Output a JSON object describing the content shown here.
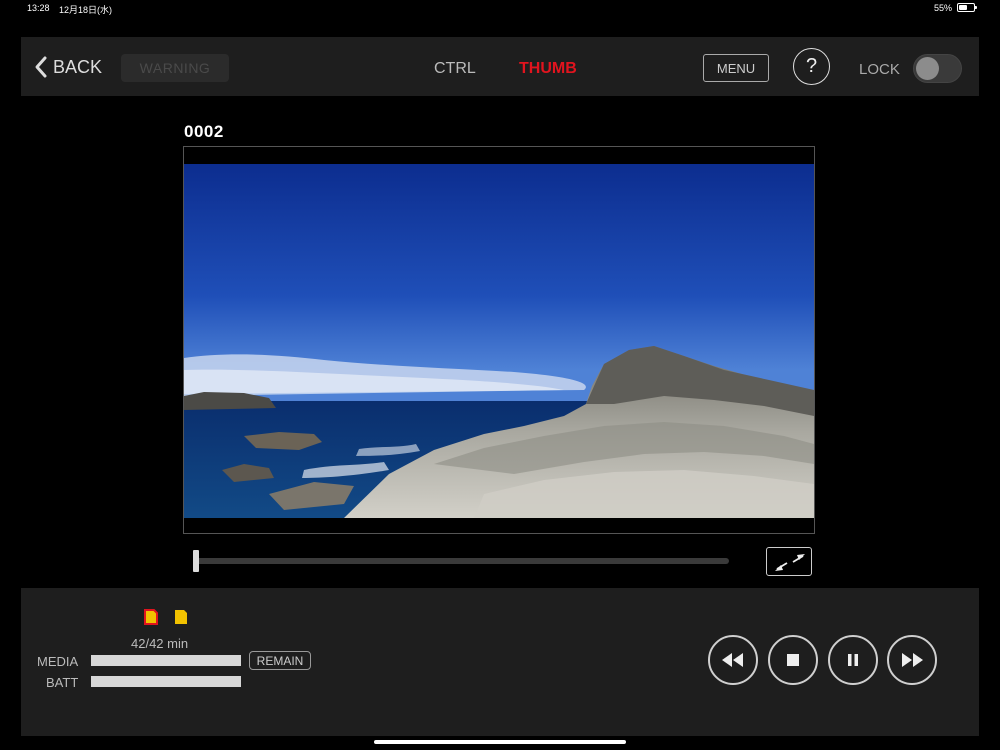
{
  "status_bar": {
    "time": "13:28",
    "date": "12月18日(水)",
    "battery": "55%",
    "battery_level": 0.55
  },
  "topbar": {
    "back_label": "BACK",
    "warning_label": "WARNING",
    "tabs": [
      {
        "label": "CTRL",
        "active": false
      },
      {
        "label": "THUMB",
        "active": true
      }
    ],
    "menu_label": "MENU",
    "help_label": "?",
    "lock_label": "LOCK",
    "lock_on": false
  },
  "viewer": {
    "clip_name": "0002",
    "playback_position": 0.0
  },
  "bottom": {
    "slots": [
      {
        "icon": "sd-card-icon",
        "color": "#f2c200",
        "active": true,
        "active_border": "#e1141e"
      },
      {
        "icon": "sd-card-icon",
        "color": "#f2c200",
        "active": false
      }
    ],
    "remain_time": "42/42 min",
    "media_label": "MEDIA",
    "media_level": 1.0,
    "batt_label": "BATT",
    "batt_level": 1.0,
    "remain_button": "REMAIN",
    "transport": [
      "rewind-icon",
      "stop-icon",
      "pause-icon",
      "fast-forward-icon"
    ]
  },
  "colors": {
    "accent": "#e1141e",
    "panel": "#1e1e1e",
    "slot": "#f2c200"
  }
}
